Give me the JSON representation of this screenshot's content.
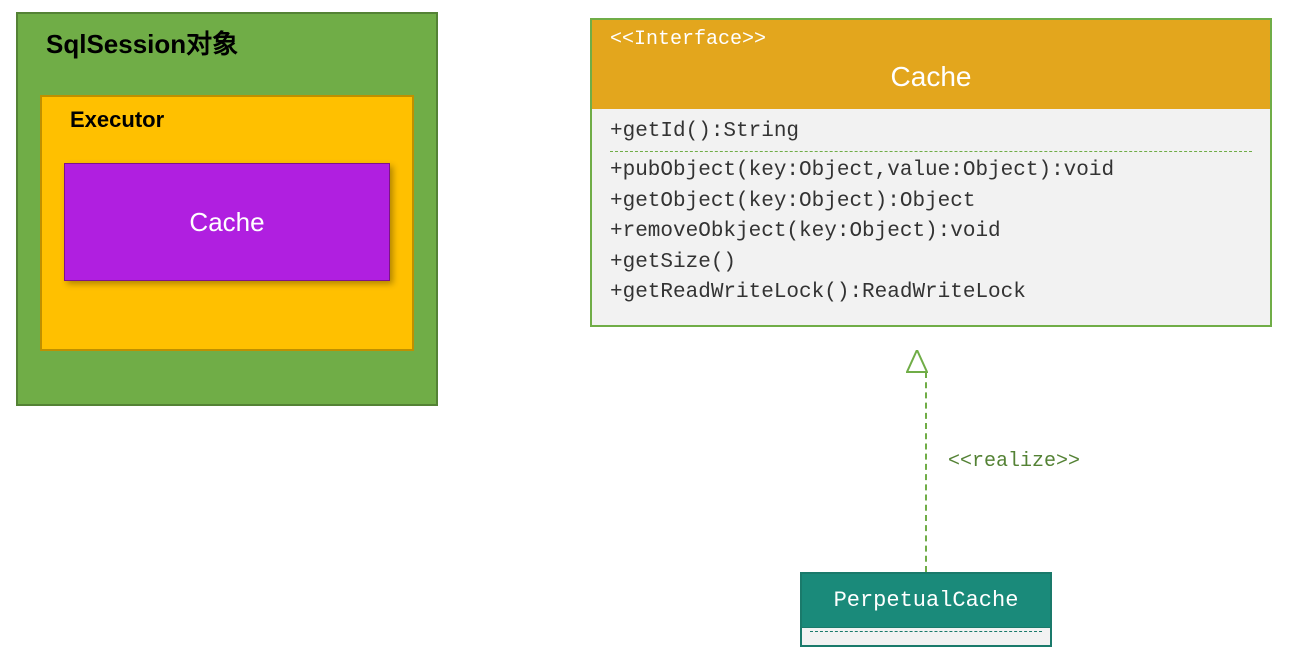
{
  "left": {
    "sqlsession": "SqlSession对象",
    "executor": "Executor",
    "cache": "Cache"
  },
  "interface": {
    "stereotype": "<<Interface>>",
    "name": "Cache",
    "methods_top": "+getId():String",
    "methods": [
      "+pubObject(key:Object,value:Object):void",
      "+getObject(key:Object):Object",
      "+removeObkject(key:Object):void",
      "+getSize()",
      "+getReadWriteLock():ReadWriteLock"
    ]
  },
  "connector": {
    "label": "<<realize>>"
  },
  "perpetual": {
    "name": "PerpetualCache"
  }
}
